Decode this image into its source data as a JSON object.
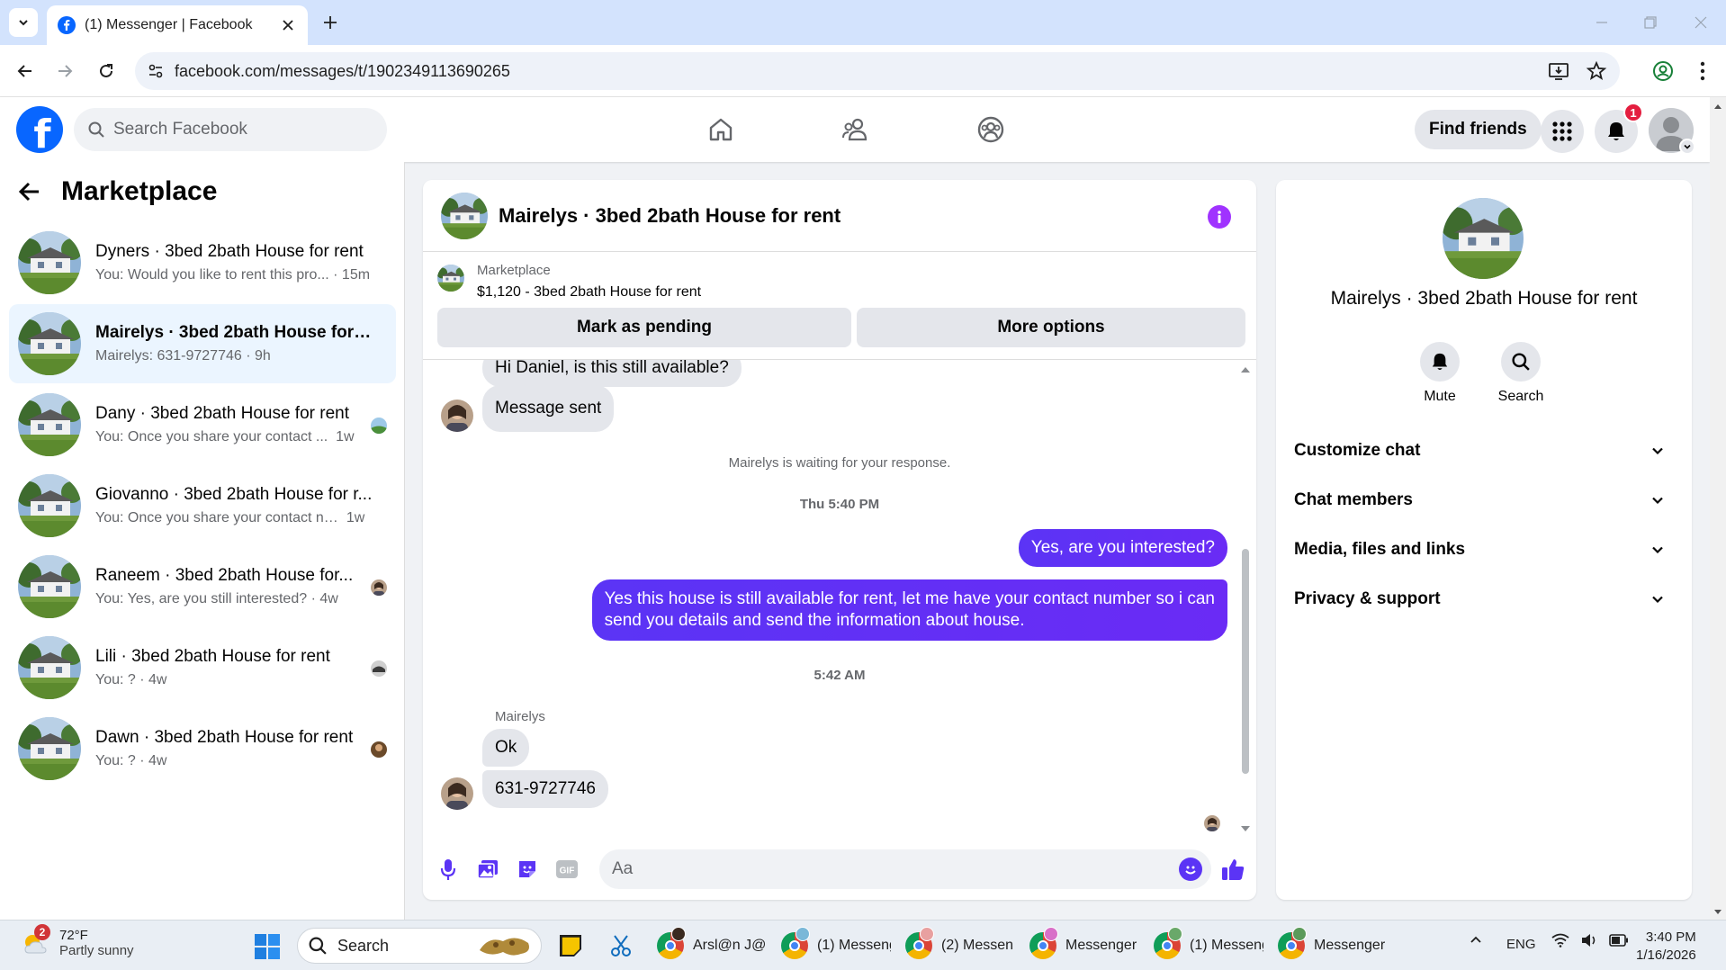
{
  "browser": {
    "tab_title": "(1) Messenger | Facebook",
    "url": "facebook.com/messages/t/1902349113690265"
  },
  "fb": {
    "search_placeholder": "Search Facebook",
    "find_friends_label": "Find friends",
    "notification_count": "1"
  },
  "left": {
    "title": "Marketplace",
    "conversations": [
      {
        "name": "Dyners · 3bed 2bath House for rent",
        "snippet": "You: Would you like to rent this pro...",
        "time": "· 15m"
      },
      {
        "name": "Mairelys · 3bed 2bath House for re...",
        "snippet": "Mairelys: 631-9727746",
        "time": "· 9h"
      },
      {
        "name": "Dany · 3bed 2bath House for rent",
        "snippet": "You: Once you share your contact ...",
        "time": "1w"
      },
      {
        "name": "Giovanno · 3bed 2bath House for r...",
        "snippet": "You: Once you share your contact nu...",
        "time": "1w"
      },
      {
        "name": "Raneem · 3bed 2bath House for...",
        "snippet": "You: Yes, are you still interested?",
        "time": "· 4w"
      },
      {
        "name": "Lili · 3bed 2bath House for rent",
        "snippet": "You: ?",
        "time": "· 4w"
      },
      {
        "name": "Dawn · 3bed 2bath House for rent",
        "snippet": "You: ?",
        "time": "· 4w"
      }
    ]
  },
  "chat": {
    "title": "Mairelys · 3bed 2bath House for rent",
    "marketplace_label": "Marketplace",
    "listing": "$1,120 - 3bed 2bath House for rent",
    "mark_pending_label": "Mark as pending",
    "more_options_label": "More options",
    "messages": {
      "m1": "Hi Daniel, is this still available?",
      "m2": "Message sent",
      "waiting": "Mairelys is waiting for your response.",
      "time1": "Thu 5:40 PM",
      "m3": "Yes, are you interested?",
      "m4_line1": "Yes this house is still available for rent, let me have your contact number so i can",
      "m4_line2": "send you details and send the information about house.",
      "time2": "5:42 AM",
      "sender": "Mairelys",
      "m5": "Ok",
      "m6": "631-9727746"
    },
    "composer_placeholder": "Aa"
  },
  "right": {
    "title": "Mairelys · 3bed 2bath House for rent",
    "mute_label": "Mute",
    "search_label": "Search",
    "sections": [
      "Customize chat",
      "Chat members",
      "Media, files and links",
      "Privacy & support"
    ]
  },
  "taskbar": {
    "temp": "72°F",
    "weather": "Partly sunny",
    "weather_badge": "2",
    "search_label": "Search",
    "apps": [
      "Arsl@n J@",
      "(1) Messeng",
      "(2) Messen",
      "Messenger",
      "(1) Messeng",
      "Messenger"
    ],
    "lang": "ENG",
    "time": "3:40 PM",
    "date": "1/16/2026"
  },
  "colors": {
    "fb_blue": "#0866ff",
    "messenger_purple": "#5b34f5",
    "info_purple": "#a033ff",
    "notif_red": "#e41e3f"
  }
}
